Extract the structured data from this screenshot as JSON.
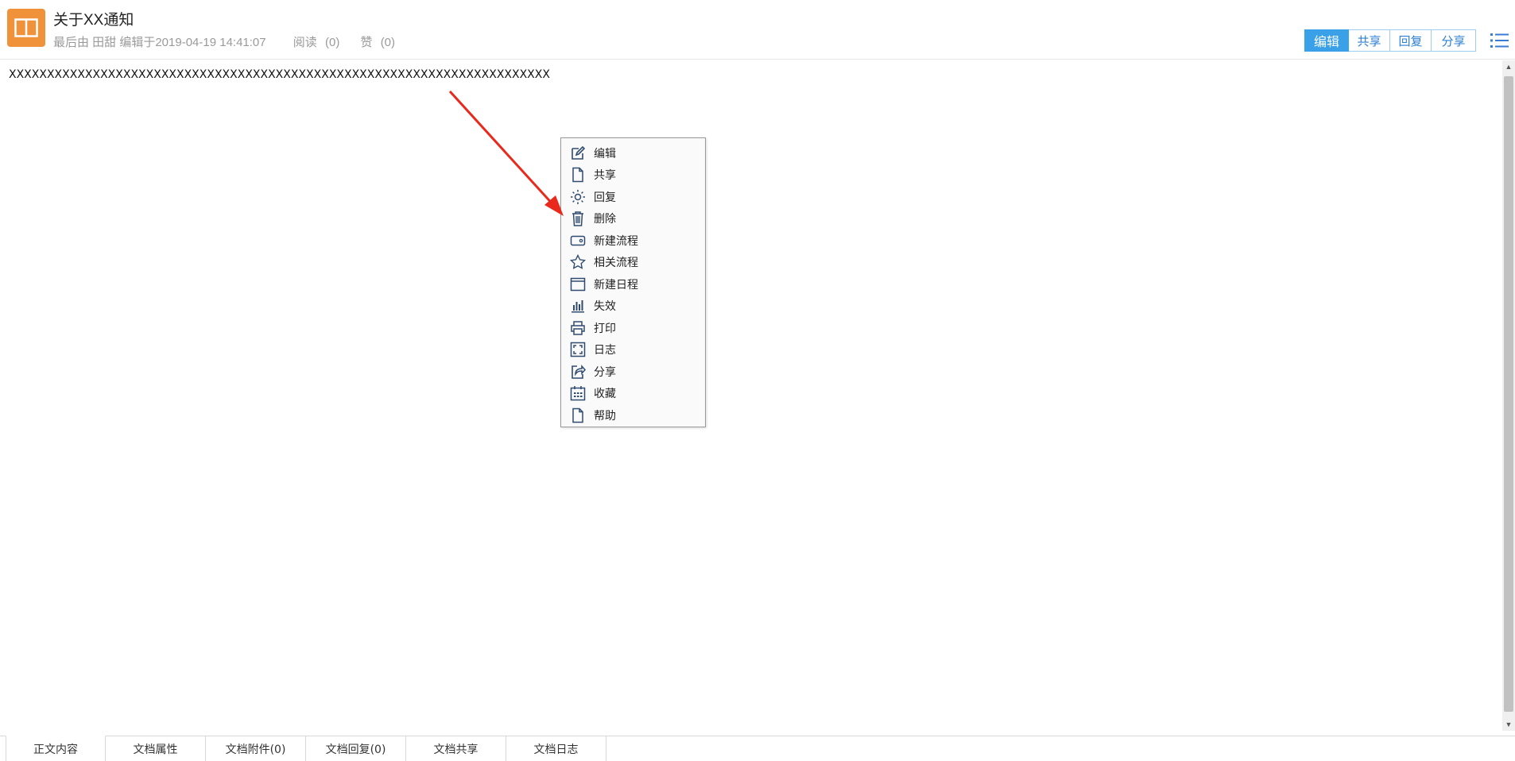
{
  "header": {
    "title": "关于XX通知",
    "meta": {
      "edited": "最后由 田甜 编辑于2019-04-19 14:41:07",
      "read_label": "阅读",
      "read_count": "(0)",
      "like_label": "赞",
      "like_count": "(0)"
    },
    "app_icon": "book-icon",
    "accent_color": "#f0923a"
  },
  "toolbar": {
    "buttons": [
      {
        "label": "编辑"
      },
      {
        "label": "共享"
      },
      {
        "label": "回复"
      },
      {
        "label": "分享"
      }
    ],
    "menu_icon": "list-icon",
    "primary_color": "#3aa0e8"
  },
  "content": {
    "text": "XXXXXXXXXXXXXXXXXXXXXXXXXXXXXXXXXXXXXXXXXXXXXXXXXXXXXXXXXXXXXXXXXXXXXXX"
  },
  "context_menu": {
    "items": [
      {
        "label": "编辑",
        "icon": "edit-icon"
      },
      {
        "label": "共享",
        "icon": "document-icon"
      },
      {
        "label": "回复",
        "icon": "sun-icon"
      },
      {
        "label": "删除",
        "icon": "trash-icon"
      },
      {
        "label": "新建流程",
        "icon": "wallet-icon"
      },
      {
        "label": "相关流程",
        "icon": "star-icon"
      },
      {
        "label": "新建日程",
        "icon": "window-icon"
      },
      {
        "label": "失效",
        "icon": "bar-chart-icon"
      },
      {
        "label": "打印",
        "icon": "printer-icon"
      },
      {
        "label": "日志",
        "icon": "fullscreen-icon"
      },
      {
        "label": "分享",
        "icon": "share-icon"
      },
      {
        "label": "收藏",
        "icon": "calendar-icon"
      },
      {
        "label": "帮助",
        "icon": "document-icon"
      }
    ],
    "icon_color": "#2f4b70"
  },
  "annotation": {
    "arrow_color": "#e8291c"
  },
  "tabs": [
    {
      "label": "正文内容"
    },
    {
      "label": "文档属性"
    },
    {
      "label": "文档附件(0)"
    },
    {
      "label": "文档回复(0)"
    },
    {
      "label": "文档共享"
    },
    {
      "label": "文档日志"
    }
  ]
}
